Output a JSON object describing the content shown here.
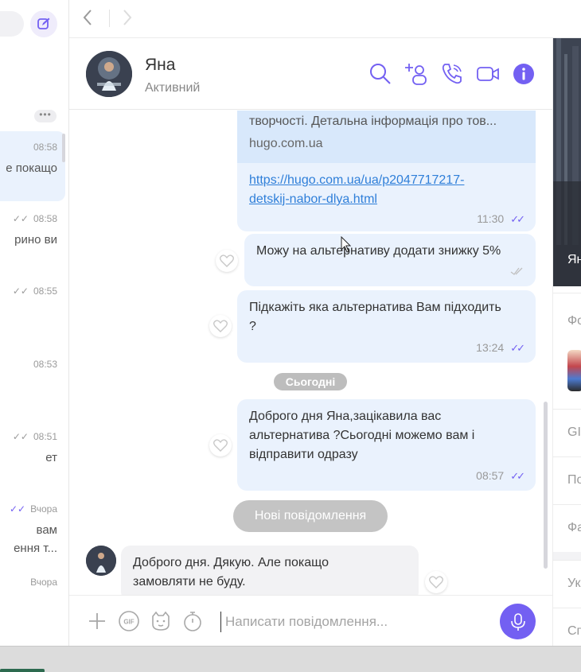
{
  "sidebar": {
    "items": [
      {
        "time": "08:58",
        "preview": "е покащо",
        "ticks": ""
      },
      {
        "time": "08:58",
        "preview": "рино ви",
        "ticks": "✓✓"
      },
      {
        "time": "08:55",
        "preview": "",
        "ticks": "✓✓"
      },
      {
        "time": "08:53",
        "preview": "",
        "ticks": ""
      },
      {
        "time": "08:51",
        "preview": "ет",
        "ticks": "✓✓"
      },
      {
        "time": "Вчора",
        "preview": "вам",
        "preview2": "ення т...",
        "ticks": "✓✓"
      },
      {
        "time": "Вчора",
        "preview": "",
        "ticks": ""
      }
    ],
    "more_label": "•••"
  },
  "nav": {
    "back": "‹",
    "forward": "›"
  },
  "header": {
    "name": "Яна",
    "status": "Активний"
  },
  "messages": {
    "link_preview": {
      "desc": "творчості. Детальна інформація про тов...",
      "domain": "hugo.com.ua"
    },
    "link_message": {
      "url_line1": "https://hugo.com.ua/ua/p2047717217-",
      "url_line2": "detskij-nabor-dlya.html",
      "time": "11:30"
    },
    "msg_discount": {
      "text": "Можу на альтернативу додати знижку 5%"
    },
    "msg_alternative": {
      "line1": "Підкажіть яка альтернатива Вам підходить",
      "line2": "?",
      "time": "13:24"
    },
    "date_separator": "Сьогодні",
    "msg_today": {
      "line1": "Доброго дня Яна,зацікавила вас",
      "line2": "альтернатива ?Сьогодні можемо вам і",
      "line3": "відправити одразу",
      "time": "08:57"
    },
    "new_messages_label": "Нові повідомлення",
    "msg_incoming": {
      "line1": "Доброго дня. Дякую. Але покащо",
      "line2": "замовляти не буду."
    }
  },
  "composer": {
    "placeholder": "Написати повідомлення...",
    "gif_label": "GIF"
  },
  "right_panel": {
    "photo_label": "Ян",
    "labels": [
      "Фо",
      "GI",
      "По",
      "Фа",
      "Ук",
      "Сп"
    ]
  },
  "colors": {
    "accent": "#7360f2",
    "bubble_out": "#eaf2fd",
    "bubble_in": "#f2f2f4",
    "link": "#2f7fd9"
  }
}
